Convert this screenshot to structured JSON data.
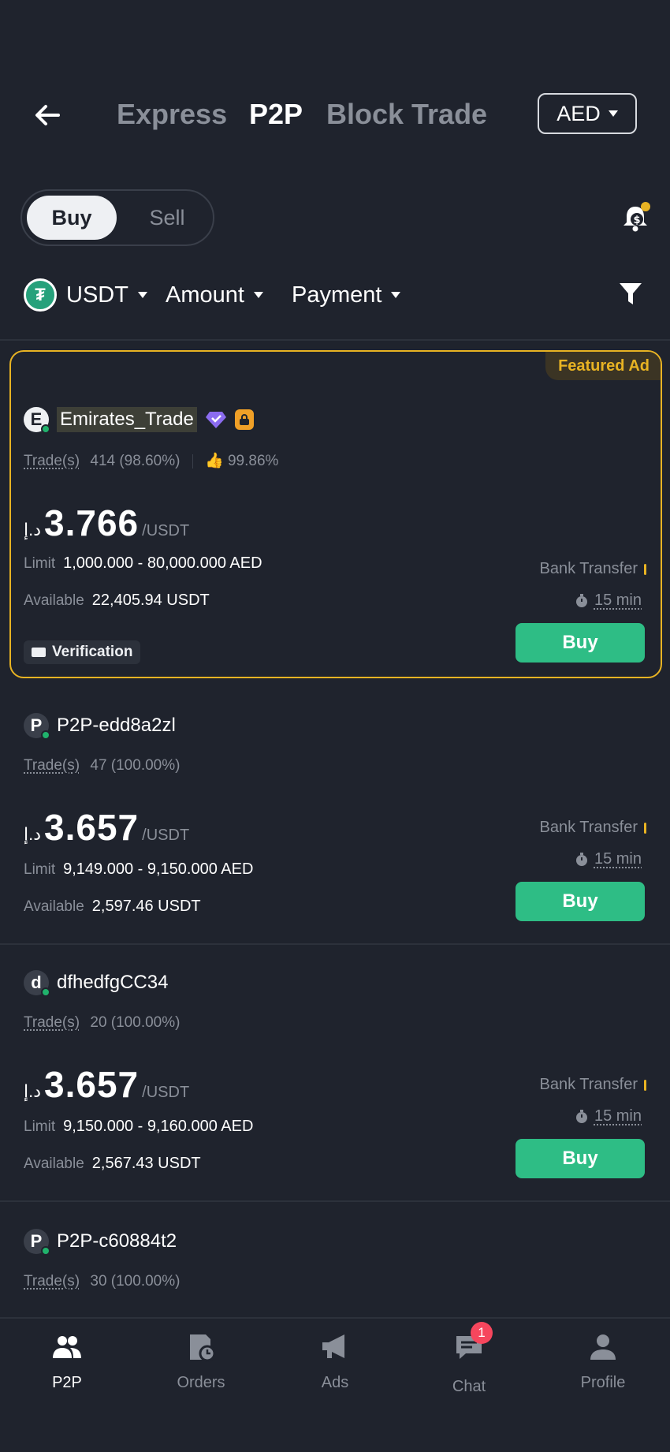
{
  "header": {
    "tabs": [
      {
        "label": "Express",
        "active": false
      },
      {
        "label": "P2P",
        "active": true
      },
      {
        "label": "Block Trade",
        "active": false
      }
    ],
    "currency": "AED"
  },
  "toggle": {
    "buy": "Buy",
    "sell": "Sell",
    "selected": "Buy"
  },
  "filters": {
    "asset": "USDT",
    "amount": "Amount",
    "payment": "Payment"
  },
  "colors": {
    "accent_green": "#2ebd85",
    "featured_gold": "#e8b323",
    "background": "#1f232d"
  },
  "ads": [
    {
      "featured": true,
      "featured_label": "Featured Ad",
      "avatar": "E",
      "name": "Emirates_Trade",
      "trades_label": "Trade(s)",
      "trades": "414 (98.60%)",
      "rating": "99.86%",
      "currency_symbol": "د.إ",
      "price": "3.766",
      "unit": "/USDT",
      "limit_label": "Limit",
      "limit": "1,000.000 - 80,000.000 AED",
      "available_label": "Available",
      "available": "22,405.94 USDT",
      "payment": "Bank Transfer",
      "time": "15 min",
      "button": "Buy",
      "verification": "Verification"
    },
    {
      "featured": false,
      "avatar": "P",
      "name": "P2P-edd8a2zl",
      "trades_label": "Trade(s)",
      "trades": "47 (100.00%)",
      "currency_symbol": "د.إ",
      "price": "3.657",
      "unit": "/USDT",
      "limit_label": "Limit",
      "limit": "9,149.000 - 9,150.000 AED",
      "available_label": "Available",
      "available": "2,597.46 USDT",
      "payment": "Bank Transfer",
      "time": "15 min",
      "button": "Buy"
    },
    {
      "featured": false,
      "avatar": "d",
      "name": "dfhedfgCC34",
      "trades_label": "Trade(s)",
      "trades": "20 (100.00%)",
      "currency_symbol": "د.إ",
      "price": "3.657",
      "unit": "/USDT",
      "limit_label": "Limit",
      "limit": "9,150.000 - 9,160.000 AED",
      "available_label": "Available",
      "available": "2,567.43 USDT",
      "payment": "Bank Transfer",
      "time": "15 min",
      "button": "Buy"
    },
    {
      "featured": false,
      "avatar": "P",
      "name": "P2P-c60884t2",
      "trades_label": "Trade(s)",
      "trades": "30 (100.00%)"
    }
  ],
  "bottom_nav": {
    "items": [
      {
        "label": "P2P",
        "icon": "users-icon",
        "active": true
      },
      {
        "label": "Orders",
        "icon": "orders-icon",
        "active": false
      },
      {
        "label": "Ads",
        "icon": "megaphone-icon",
        "active": false
      },
      {
        "label": "Chat",
        "icon": "chat-icon",
        "active": false,
        "badge": "1"
      },
      {
        "label": "Profile",
        "icon": "profile-icon",
        "active": false
      }
    ]
  }
}
